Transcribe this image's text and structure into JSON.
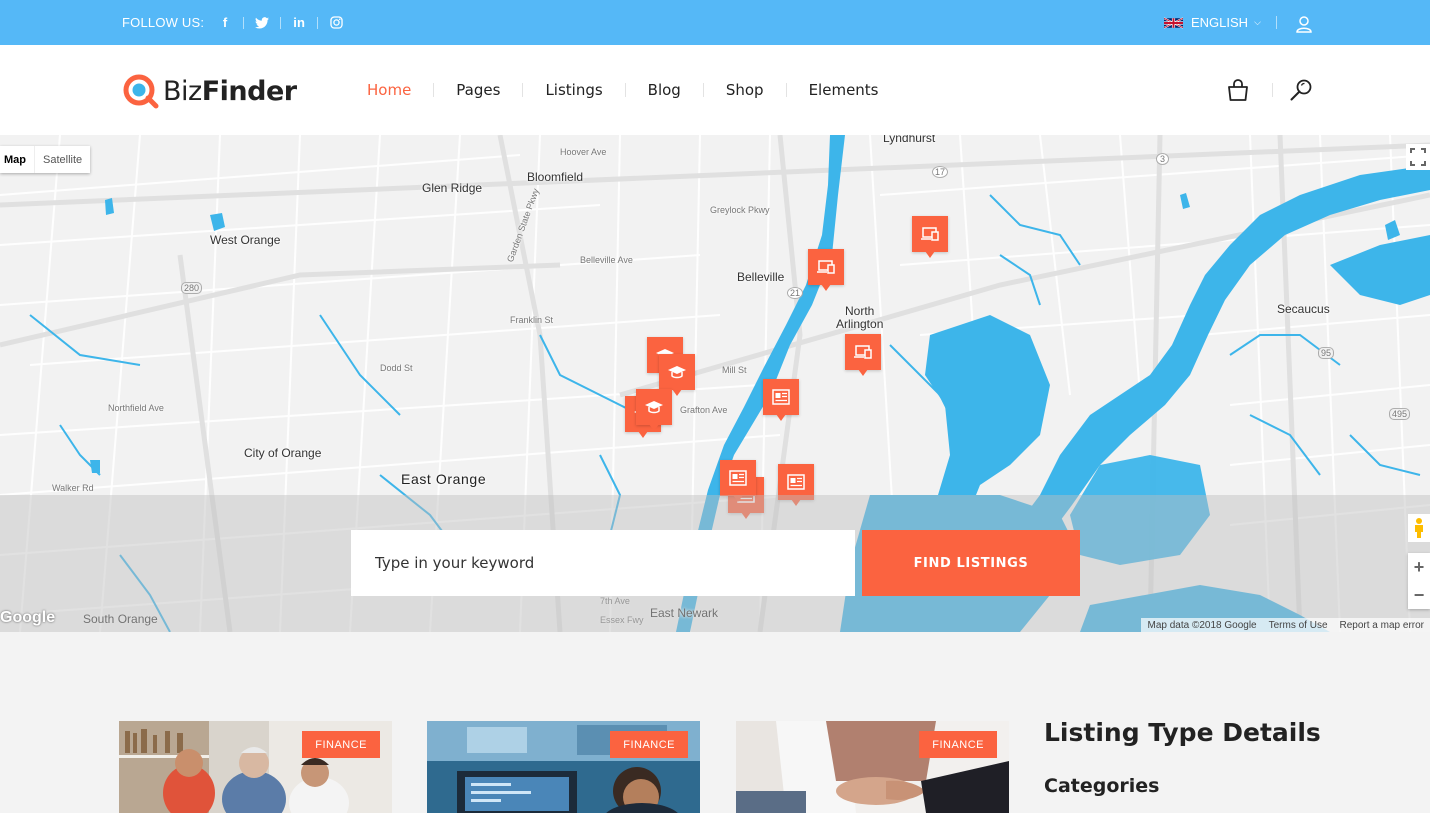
{
  "topbar": {
    "follow_label": "FOLLOW US:",
    "social_icons": [
      "facebook-icon",
      "twitter-icon",
      "linkedin-icon",
      "instagram-icon"
    ],
    "language": "ENGLISH",
    "background_color": "#55b8f7"
  },
  "header": {
    "logo_part1": "Biz",
    "logo_part2": "Finder",
    "nav": [
      "Home",
      "Pages",
      "Listings",
      "Blog",
      "Shop",
      "Elements"
    ],
    "active_nav": "Home",
    "accent_color": "#fb6340"
  },
  "map": {
    "type_options": [
      "Map",
      "Satellite"
    ],
    "selected_type": "Map",
    "places": {
      "lyndhurst": "Lyndhurst",
      "bloomfield": "Bloomfield",
      "glen_ridge": "Glen Ridge",
      "west_orange": "West Orange",
      "belleville": "Belleville",
      "north_arlington_1": "North",
      "north_arlington_2": "Arlington",
      "secaucus": "Secaucus",
      "city_of_orange": "City of Orange",
      "east_orange": "East Orange",
      "south_orange": "South Orange",
      "east_newark": "East Newark"
    },
    "roads": {
      "hoover": "Hoover Ave",
      "greylock": "Greylock Pkwy",
      "garden_state": "Garden State Pkwy",
      "belleville_ave": "Belleville Ave",
      "franklin": "Franklin St",
      "mill": "Mill St",
      "dodd": "Dodd St",
      "grafton": "Grafton Ave",
      "walker": "Walker Rd",
      "essex": "Essex Fwy",
      "seventh": "7th Ave",
      "northfield": "Northfield Ave"
    },
    "route_markers": [
      "280",
      "21",
      "17",
      "3",
      "95",
      "495"
    ],
    "attribution": [
      "Map data ©2018 Google",
      "Terms of Use",
      "Report a map error"
    ],
    "google": "Google",
    "water_color": "#3db5ea"
  },
  "search": {
    "placeholder": "Type in your keyword",
    "button_label": "FIND LISTINGS"
  },
  "listings": [
    {
      "category": "FINANCE"
    },
    {
      "category": "FINANCE"
    },
    {
      "category": "FINANCE"
    }
  ],
  "sidebar": {
    "title": "Listing Type Details",
    "subtitle": "Categories"
  },
  "pins": [
    {
      "icon": "devices-icon"
    },
    {
      "icon": "devices-icon"
    },
    {
      "icon": "devices-icon"
    },
    {
      "icon": "graduation-cap-icon"
    },
    {
      "icon": "graduation-cap-icon"
    },
    {
      "icon": "graduation-cap-icon"
    },
    {
      "icon": "graduation-cap-icon"
    },
    {
      "icon": "news-icon"
    },
    {
      "icon": "news-icon"
    },
    {
      "icon": "news-icon"
    },
    {
      "icon": "news-icon"
    }
  ]
}
